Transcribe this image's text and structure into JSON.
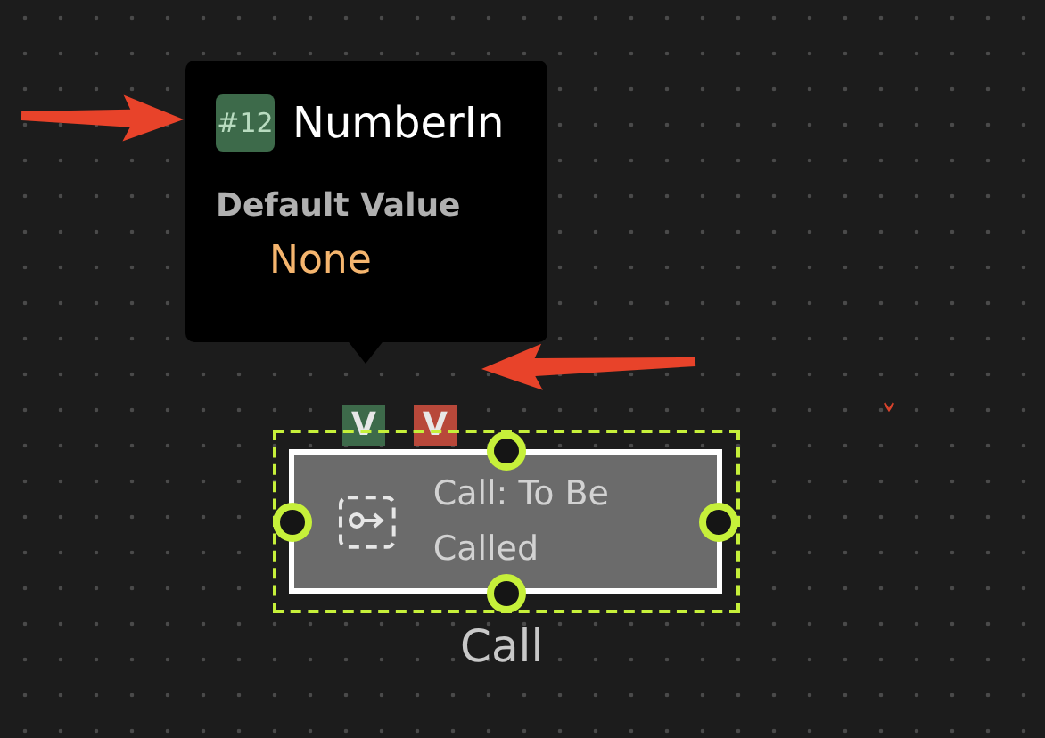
{
  "tooltip": {
    "badge": "#12",
    "title": "NumberIn",
    "label": "Default Value",
    "value": "None"
  },
  "ports": [
    {
      "label": "V",
      "color": "#3d6a4a"
    },
    {
      "label": "V",
      "color": "#b8483a"
    }
  ],
  "node": {
    "text": "Call: To Be Called",
    "selected": true,
    "caption": "Call"
  }
}
